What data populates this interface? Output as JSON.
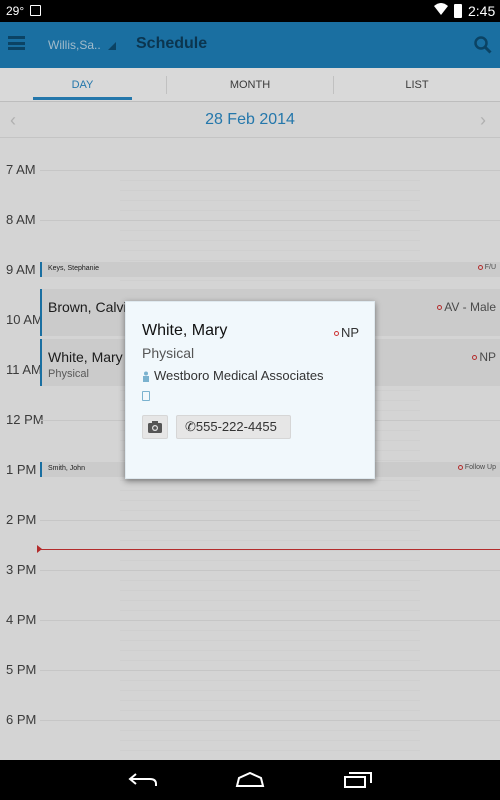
{
  "status_bar": {
    "temperature": "29°",
    "time": "2:45"
  },
  "app_bar": {
    "location": "Willis,Sa..",
    "title": "Schedule"
  },
  "tabs": [
    {
      "label": "DAY"
    },
    {
      "label": "MONTH"
    },
    {
      "label": "LIST"
    }
  ],
  "date_nav": {
    "date": "28 Feb 2014"
  },
  "hours": [
    "7 AM",
    "8 AM",
    "9 AM",
    "10 AM",
    "11 AM",
    "12 PM",
    "1 PM",
    "2 PM",
    "3 PM",
    "4 PM",
    "5 PM",
    "6 PM"
  ],
  "appointments": [
    {
      "name": "Keys, Stephanie",
      "status": "F/U"
    },
    {
      "name": "Brown, Calvi",
      "status": "AV - Male"
    },
    {
      "name": "White, Mary",
      "type": "Physical",
      "status": "NP"
    },
    {
      "name": "Smith, John",
      "status": "Follow Up"
    }
  ],
  "popup": {
    "name": "White, Mary",
    "status": "NP",
    "type": "Physical",
    "practice": "Westboro Medical Associates",
    "phone": "555-222-4455"
  },
  "colors": {
    "primary": "#1e7fb8",
    "accent": "#2a88c3",
    "status_ring": "#cc3333",
    "current_time_line": "#cc3333"
  },
  "icons": [
    "menu-icon",
    "search-icon",
    "camera-icon",
    "phone-icon",
    "practice-icon",
    "document-icon",
    "back-icon",
    "home-icon",
    "recents-icon"
  ]
}
